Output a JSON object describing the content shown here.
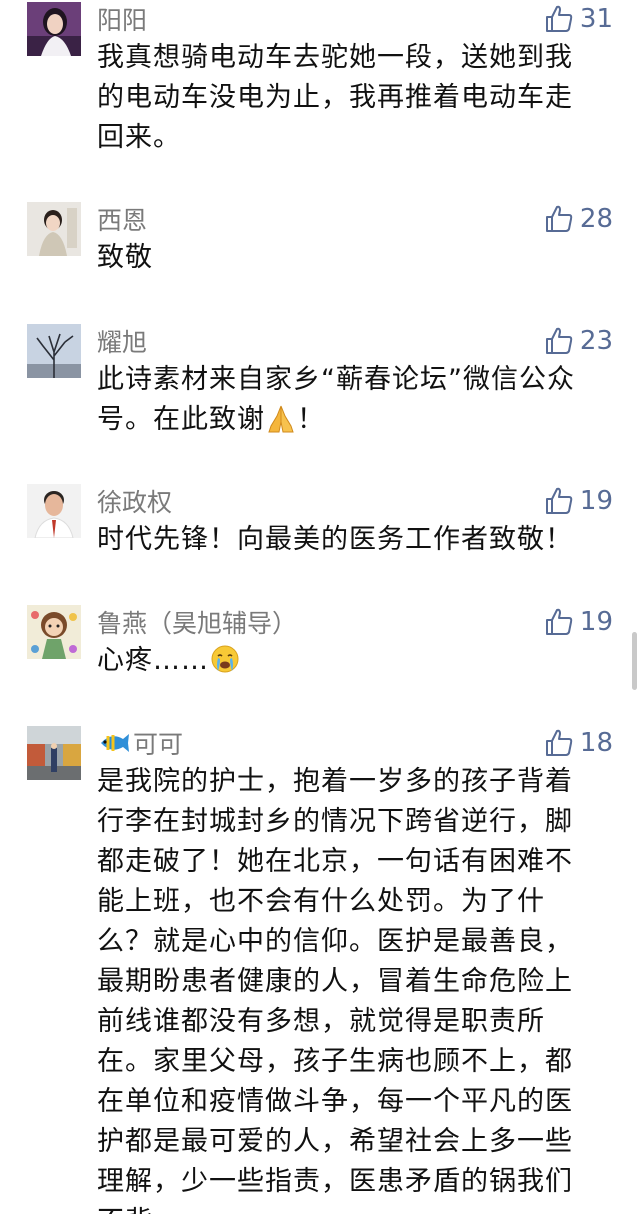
{
  "comments": [
    {
      "name": "阳阳",
      "likes": "31",
      "avatar_icon": "woman-portrait-avatar",
      "lines": [
        "我真想骑电动车去驼她一段，送她到我",
        "的电动车没电为止，我再推着电动车走",
        "回来。"
      ]
    },
    {
      "name": "西恩",
      "likes": "28",
      "avatar_icon": "child-portrait-avatar",
      "lines": [
        "致敬"
      ]
    },
    {
      "name": "耀旭",
      "likes": "23",
      "avatar_icon": "bare-tree-avatar",
      "lines": [
        "此诗素材来自家乡“蕲春论坛”微信公众",
        "号。在此致谢",
        "！"
      ]
    },
    {
      "name": "徐政权",
      "likes": "19",
      "avatar_icon": "man-portrait-avatar",
      "lines": [
        "时代先锋！向最美的医务工作者致敬！"
      ]
    },
    {
      "name": "鲁燕（昊旭辅导）",
      "likes": "19",
      "avatar_icon": "cartoon-girl-drawing-avatar",
      "lines": [
        "心疼……"
      ]
    },
    {
      "name": "可可",
      "likes": "18",
      "avatar_icon": "street-scene-avatar",
      "lines": [
        "是我院的护士，抱着一岁多的孩子背着",
        "行李在封城封乡的情况下跨省逆行，脚",
        "都走破了！她在北京，一句话有困难不",
        "能上班，也不会有什么处罚。为了什",
        "么？就是心中的信仰。医护是最善良，",
        "最期盼患者健康的人，冒着生命危险上",
        "前线谁都没有多想，就觉得是职责所",
        "在。家里父母，孩子生病也顾不上，都",
        "在单位和疫情做斗争，每一个平凡的医",
        "护都是最可爱的人，希望社会上多一些",
        "理解，少一些指责，医患矛盾的锅我们",
        "不背"
      ]
    }
  ],
  "icons": {
    "like": "thumbs-up-icon",
    "praying_hands": "praying-hands-emoji",
    "crying_face": "crying-face-emoji",
    "fish": "tropical-fish-emoji"
  },
  "colors": {
    "like_blue": "#576b95",
    "name_gray": "#7a7a7a",
    "text_black": "#111111"
  }
}
